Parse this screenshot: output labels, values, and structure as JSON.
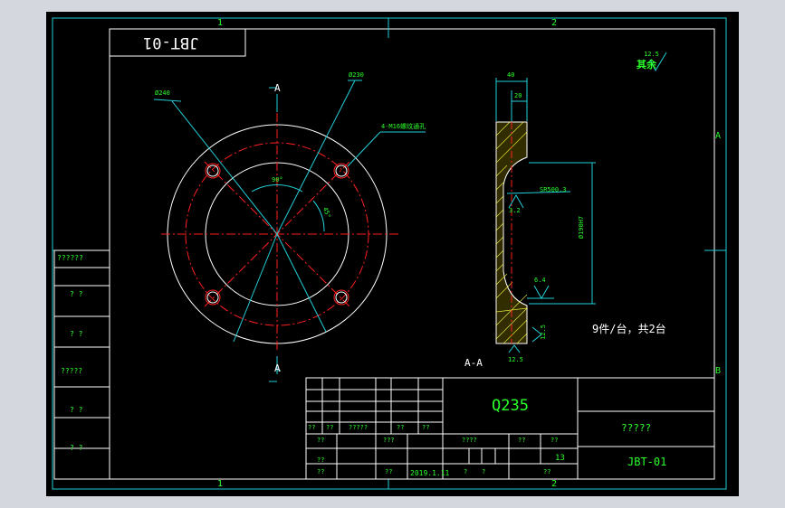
{
  "zone_labels": {
    "top_1": "1",
    "top_2": "2",
    "bottom_1": "1",
    "bottom_2": "2",
    "right_a": "A",
    "right_b": "B"
  },
  "stamp_mirrored": "JBT-01",
  "section_marks": {
    "top": "A",
    "bottom": "A",
    "view_title": "A-A"
  },
  "dimensions": {
    "dia_240": "Ø240",
    "dia_230": "Ø230",
    "holes_note": "4-M16螺纹通孔",
    "angle_90": "90°",
    "angle_45": "45°",
    "width_40": "40",
    "width_20": "20",
    "sr_note": "SR500.3",
    "rough_32": "3.2",
    "rough_64": "6.4",
    "rough_125": "12.5",
    "rough_125_bottom": "12.5",
    "vertical_dim": "Ø190H7"
  },
  "roughness_other": {
    "label": "其余",
    "value": "12.5"
  },
  "quantity_note": "9件/台，共2台",
  "title_block": {
    "material": "Q235",
    "part_name": "?????",
    "drawing_no": "JBT-01",
    "date": "2019.1.11",
    "sheet_count": "13",
    "cells": {
      "r1": "??",
      "r2": "??",
      "r3": "?????",
      "r4": "??",
      "r5": "??",
      "r6": "???",
      "r7": "????",
      "r8": "??",
      "r9": "??",
      "r10": "??",
      "r11": "??",
      "r12": "?",
      "r13": "?",
      "r14": "??"
    }
  },
  "left_sidebar": [
    "??????",
    "? ?",
    "? ?",
    "?????",
    "? ?",
    "? ?"
  ]
}
